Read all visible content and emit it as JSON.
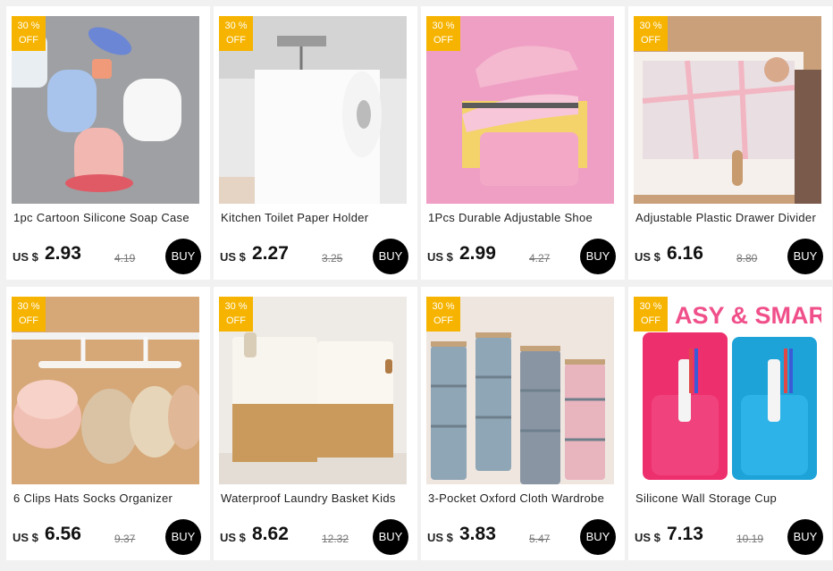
{
  "products": [
    {
      "title": "1pc Cartoon Silicone Soap Case",
      "currency": "US $",
      "price": "2.93",
      "old_price": "4.19",
      "badge_line1": "30 %",
      "badge_line2": "OFF",
      "buy_label": "BUY"
    },
    {
      "title": "Kitchen Toilet Paper Holder",
      "currency": "US $",
      "price": "2.27",
      "old_price": "3.25",
      "badge_line1": "30 %",
      "badge_line2": "OFF",
      "buy_label": "BUY"
    },
    {
      "title": "1Pcs Durable Adjustable Shoe",
      "currency": "US $",
      "price": "2.99",
      "old_price": "4.27",
      "badge_line1": "30 %",
      "badge_line2": "OFF",
      "buy_label": "BUY"
    },
    {
      "title": "Adjustable Plastic Drawer Divider",
      "currency": "US $",
      "price": "6.16",
      "old_price": "8.80",
      "badge_line1": "30 %",
      "badge_line2": "OFF",
      "buy_label": "BUY"
    },
    {
      "title": "6 Clips Hats Socks Organizer",
      "currency": "US $",
      "price": "6.56",
      "old_price": "9.37",
      "badge_line1": "30 %",
      "badge_line2": "OFF",
      "buy_label": "BUY"
    },
    {
      "title": "Waterproof Laundry Basket Kids",
      "currency": "US $",
      "price": "8.62",
      "old_price": "12.32",
      "badge_line1": "30 %",
      "badge_line2": "OFF",
      "buy_label": "BUY"
    },
    {
      "title": "3-Pocket Oxford Cloth Wardrobe",
      "currency": "US $",
      "price": "3.83",
      "old_price": "5.47",
      "badge_line1": "30 %",
      "badge_line2": "OFF",
      "buy_label": "BUY"
    },
    {
      "title": "Silicone Wall Storage Cup",
      "currency": "US $",
      "price": "7.13",
      "old_price": "10.19",
      "badge_line1": "30 %",
      "badge_line2": "OFF",
      "buy_label": "BUY"
    }
  ],
  "image_text": {
    "easy_smart": "ASY & SMART"
  },
  "colors": {
    "badge": "#f6b400",
    "buy_button": "#000000",
    "background": "#f1f1f1"
  }
}
